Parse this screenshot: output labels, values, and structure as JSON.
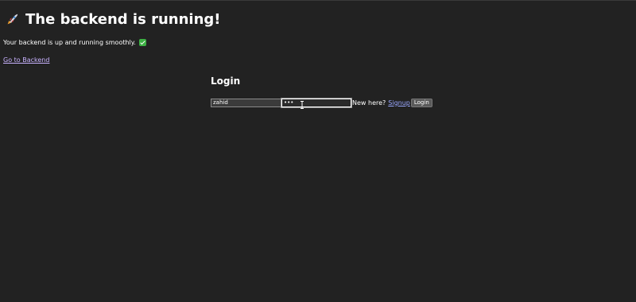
{
  "header": {
    "title": "The backend is running!",
    "icon": "rocket-icon"
  },
  "status": {
    "message": "Your backend is up and running smoothly.",
    "icon": "check-icon",
    "icon_color": "#3cb043"
  },
  "links": {
    "backend_label": "Go to Backend"
  },
  "login": {
    "title": "Login",
    "username_value": "zahid",
    "password_value": "•••",
    "new_here_text": "New here?",
    "signup_label": "Signup",
    "button_label": "Login"
  },
  "colors": {
    "background": "#222222",
    "link_color": "#c9b3ff",
    "signup_color": "#9aa8ff"
  }
}
